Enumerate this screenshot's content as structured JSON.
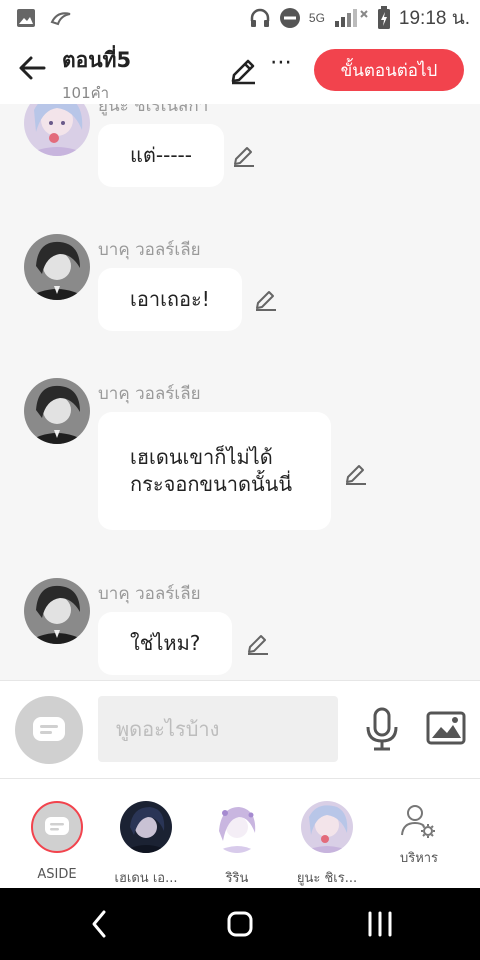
{
  "status_bar": {
    "network": "5G",
    "time": "19:18 น."
  },
  "header": {
    "title": "ตอนที่5",
    "subtitle": "101คำ",
    "next_button": "ขั้นตอนต่อไป",
    "more_label": "⋯"
  },
  "messages": [
    {
      "sender": "ยูนะ ชิเรเนสกา",
      "text": "แต่-----"
    },
    {
      "sender": "บาคุ วอลร์เลีย",
      "text": "เอาเถอะ!"
    },
    {
      "sender": "บาคุ วอลร์เลีย",
      "text": "เฮเดนเขาก็ไม่ได้กระจอกขนาดนั้นนี่"
    },
    {
      "sender": "บาคุ วอลร์เลีย",
      "text": "ใช่ไหม?"
    }
  ],
  "composer": {
    "placeholder": "พูดอะไรบ้าง"
  },
  "cast": [
    {
      "label": "ASIDE"
    },
    {
      "label": "เฮเดน เอ..."
    },
    {
      "label": "ริริน"
    },
    {
      "label": "ยูนะ ชิเร..."
    },
    {
      "label": "บริหาร"
    }
  ],
  "colors": {
    "accent": "#f2434d",
    "bubble": "#ffffff",
    "background": "#f6f6f6"
  },
  "icons": {
    "back": "arrow-left-icon",
    "edit": "pencil-icon",
    "mic": "microphone-icon",
    "image": "image-icon",
    "manage": "person-gear-icon"
  }
}
